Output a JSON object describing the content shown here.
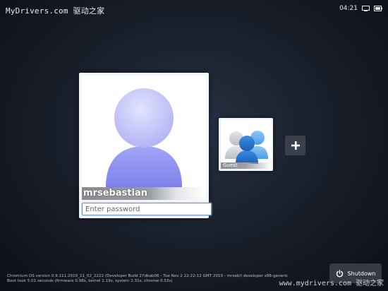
{
  "watermark": {
    "top_left": "MyDrivers.com 驱动之家",
    "bottom_right": "www.mydrivers.com 驱动之家"
  },
  "status_bar": {
    "time": "04:21",
    "icons": [
      "network-icon",
      "battery-icon"
    ]
  },
  "user": {
    "name": "mrsebastian",
    "password_placeholder": "Enter password",
    "password_value": ""
  },
  "guest": {
    "label": "Guest"
  },
  "add_user": {
    "icon": "plus-icon"
  },
  "footer": {
    "version_line1": "Chromium OS version 0.9.111.2010_11_02_2222 (Developer Build 27dbab06 - Tue Nov  2 22:22:12 GMT 2010 - mrsebl) developer x86-generic",
    "version_line2": "Boot took 5.01 seconds (firmware 0.98s, kernel 1.19s, system 2.31s, chrome 0.53s)"
  },
  "shutdown": {
    "label": "Shutdown",
    "icon": "power-icon"
  },
  "colors": {
    "avatar_head": "#c4c6f8",
    "avatar_body": "#8f92ef",
    "input_focus": "#6b8fcf",
    "guest_blue": "#2a7bd6"
  }
}
